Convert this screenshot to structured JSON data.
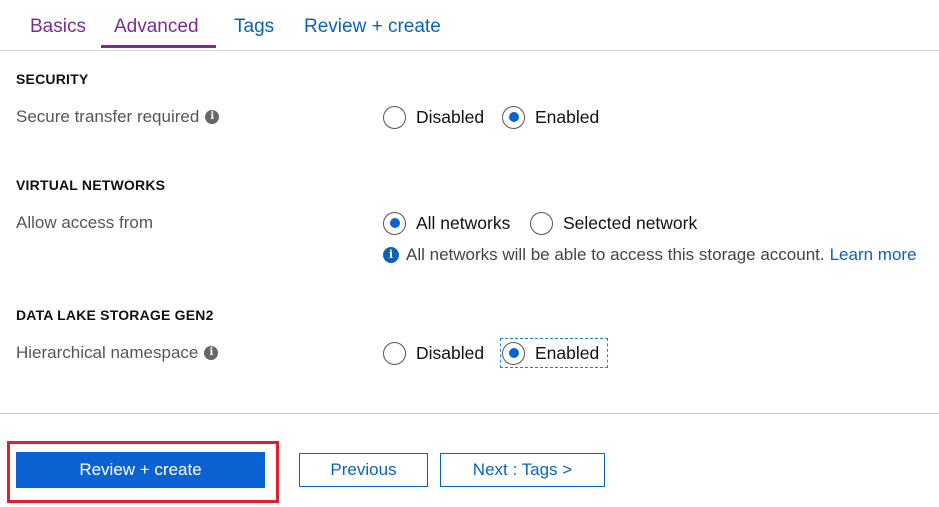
{
  "tabs": {
    "basics": "Basics",
    "advanced": "Advanced",
    "tags": "Tags",
    "review": "Review + create",
    "active": "Advanced"
  },
  "security": {
    "heading": "SECURITY",
    "label": "Secure transfer required",
    "options": {
      "disabled": "Disabled",
      "enabled": "Enabled"
    },
    "selected": "Enabled"
  },
  "virtual_networks": {
    "heading": "VIRTUAL NETWORKS",
    "label": "Allow access from",
    "options": {
      "all": "All networks",
      "selected": "Selected network"
    },
    "selected": "All networks",
    "info": "All networks will be able to access this storage account.",
    "learn_more": "Learn more"
  },
  "data_lake": {
    "heading": "DATA LAKE STORAGE GEN2",
    "label": "Hierarchical namespace",
    "options": {
      "disabled": "Disabled",
      "enabled": "Enabled"
    },
    "selected": "Enabled"
  },
  "footer": {
    "review_create": "Review + create",
    "previous": "Previous",
    "next": "Next : Tags >"
  },
  "colors": {
    "accent_purple": "#7a2c93",
    "link_blue": "#0b63b8",
    "primary_button": "#0b63d3",
    "highlight_red": "#e0202e"
  },
  "icons": {
    "info_grey": "info-icon",
    "info_blue": "info-icon"
  }
}
